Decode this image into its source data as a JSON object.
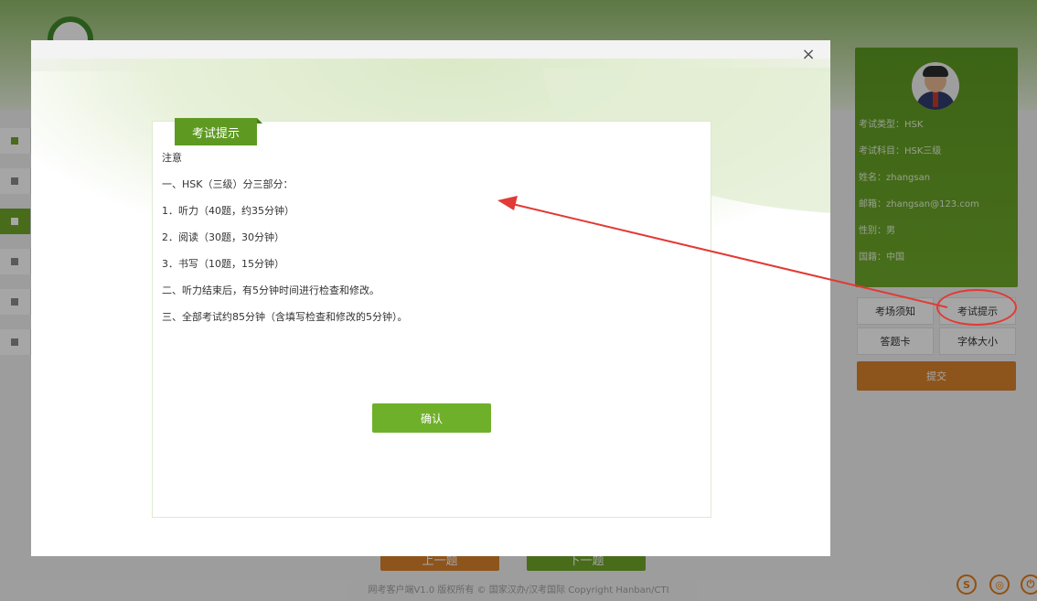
{
  "background": {
    "logo_text": "",
    "footer": {
      "prev_label": "上一题",
      "next_label": "下一题",
      "copyright": "网考客户端V1.0 版权所有 © 国家汉办/汉考国际 Copyright Hanban/CTI"
    }
  },
  "sidebar_right": {
    "info": {
      "exam_type": "考试类型：HSK",
      "exam_subject": "考试科目：HSK三级",
      "name": "姓名：zhangsan",
      "email": "邮箱：zhangsan@123.com",
      "gender": "性别：男",
      "nationality": "国籍：中国"
    },
    "buttons": {
      "notice": "考场须知",
      "tips": "考试提示",
      "answer_card": "答题卡",
      "font_size": "字体大小",
      "submit": "提交"
    }
  },
  "modal": {
    "close_label": "×",
    "tab_label": "考试提示",
    "lines": [
      "注意",
      "一、HSK（三级）分三部分：",
      "1．听力（40题，约35分钟）",
      "2．阅读（30题，30分钟）",
      "3．书写（10题，15分钟）",
      "二、听力结束后，有5分钟时间进行检查和修改。",
      "三、全部考试约85分钟（含填写检查和修改的5分钟）。"
    ],
    "confirm_label": "确认"
  },
  "colors": {
    "brand_green": "#6fa628",
    "accent_orange": "#d9822b",
    "annotation_red": "#e23a34"
  }
}
